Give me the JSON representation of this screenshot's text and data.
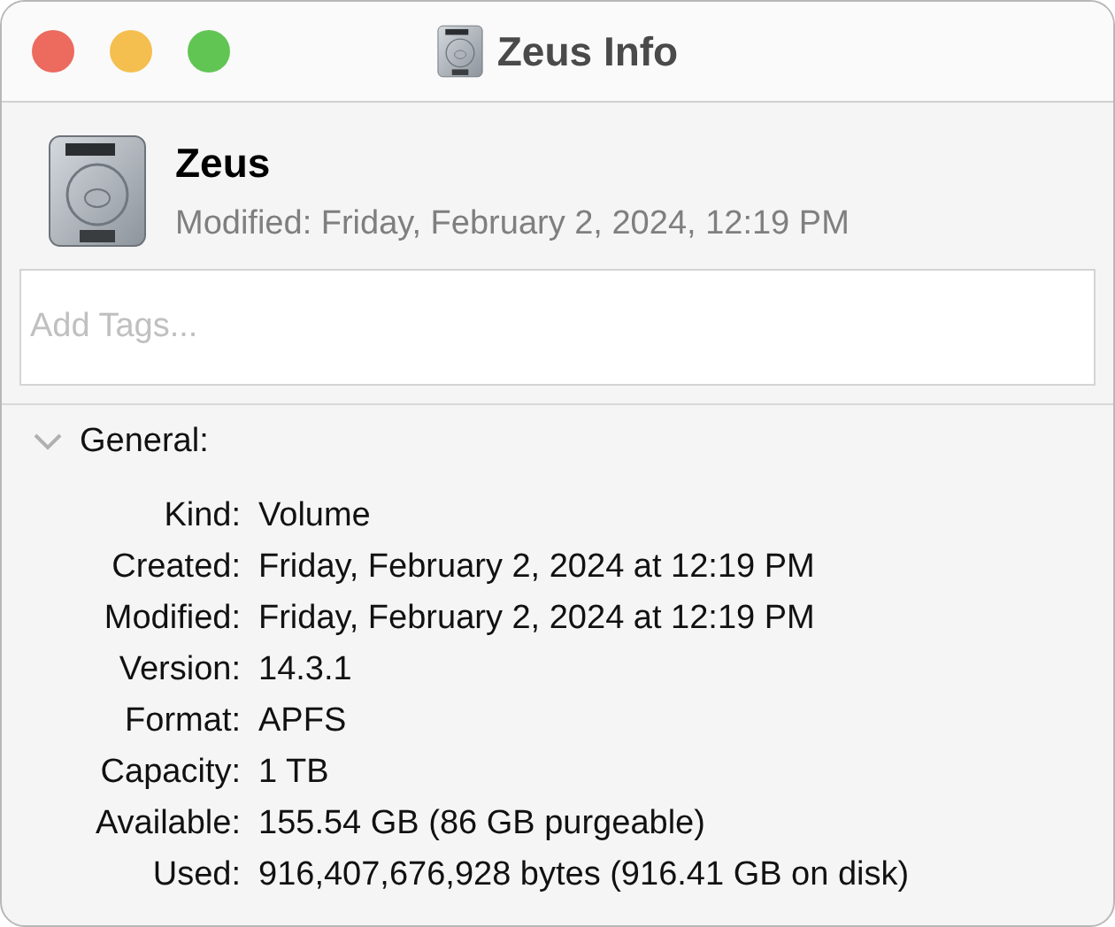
{
  "window": {
    "title": "Zeus Info"
  },
  "header": {
    "name": "Zeus",
    "modified": "Modified: Friday, February 2, 2024, 12:19 PM"
  },
  "tags": {
    "placeholder": "Add Tags..."
  },
  "section": {
    "title": "General:",
    "expanded": true,
    "rows": [
      {
        "label": "Kind:",
        "value": "Volume"
      },
      {
        "label": "Created:",
        "value": "Friday, February 2, 2024 at 12:19 PM"
      },
      {
        "label": "Modified:",
        "value": "Friday, February 2, 2024 at 12:19 PM"
      },
      {
        "label": "Version:",
        "value": "14.3.1"
      },
      {
        "label": "Format:",
        "value": "APFS"
      },
      {
        "label": "Capacity:",
        "value": "1 TB"
      },
      {
        "label": "Available:",
        "value": "155.54 GB (86 GB purgeable)"
      },
      {
        "label": "Used:",
        "value": "916,407,676,928 bytes (916.41 GB on disk)"
      }
    ]
  }
}
